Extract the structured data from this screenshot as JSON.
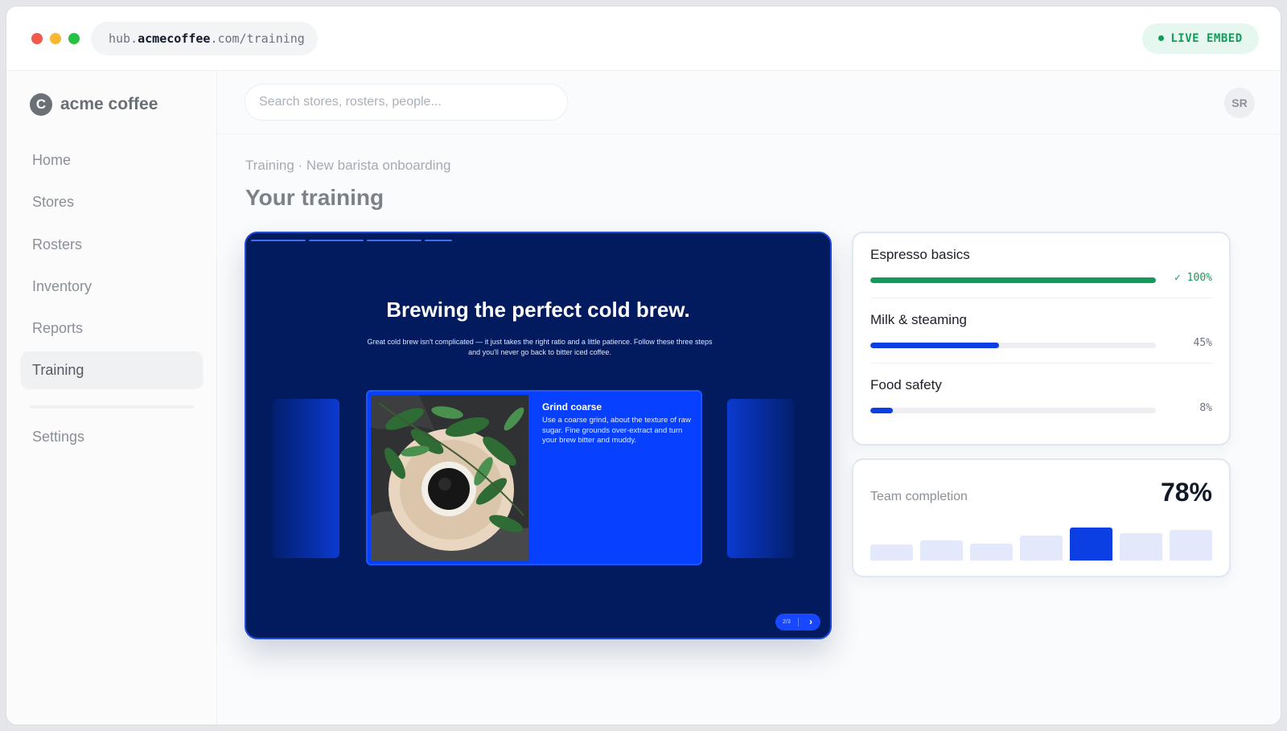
{
  "browser": {
    "url_prefix": "hub.",
    "url_host": "acmecoffee",
    "url_suffix": ".com/training",
    "badge": "LIVE EMBED"
  },
  "sidebar": {
    "brand_initial": "C",
    "brand_name": "acme coffee",
    "items": [
      {
        "label": "Home",
        "active": false
      },
      {
        "label": "Stores",
        "active": false
      },
      {
        "label": "Rosters",
        "active": false
      },
      {
        "label": "Inventory",
        "active": false
      },
      {
        "label": "Reports",
        "active": false
      },
      {
        "label": "Training",
        "active": true
      }
    ],
    "settings_label": "Settings"
  },
  "header": {
    "search_placeholder": "Search stores, rosters, people...",
    "avatar_initials": "SR"
  },
  "page": {
    "breadcrumb": "Training · New barista onboarding",
    "title": "Your training"
  },
  "embed": {
    "title": "Brewing the perfect cold brew.",
    "subtitle": "Great cold brew isn't complicated — it just takes the right ratio and a little patience. Follow these three steps and you'll never go back to bitter iced coffee.",
    "card_heading": "Grind coarse",
    "card_text": "Use a coarse grind, about the texture of raw sugar. Fine grounds over-extract and turn your brew bitter and muddy.",
    "pager": "2/3",
    "next_glyph": "›"
  },
  "courses": [
    {
      "name": "Espresso basics",
      "progress": 1.0,
      "pct_label": "✓ 100%",
      "color": "#139a5b",
      "done": true
    },
    {
      "name": "Milk & steaming",
      "progress": 0.45,
      "pct_label": "45%",
      "color": "#0b3ee3",
      "done": false
    },
    {
      "name": "Food safety",
      "progress": 0.08,
      "pct_label": "8%",
      "color": "#0b3ee3",
      "done": false
    }
  ],
  "team": {
    "label": "Team completion",
    "value": "78%",
    "bars": [
      0.4,
      0.5,
      0.42,
      0.62,
      0.82,
      0.68,
      0.75
    ],
    "highlight_index": 4,
    "colors": {
      "bar": "#e3e9fb",
      "highlight": "#0b3ee3"
    }
  },
  "colors": {
    "accent": "#0b3ee3",
    "embed_bg": "#011b5e",
    "success": "#139a5b"
  }
}
